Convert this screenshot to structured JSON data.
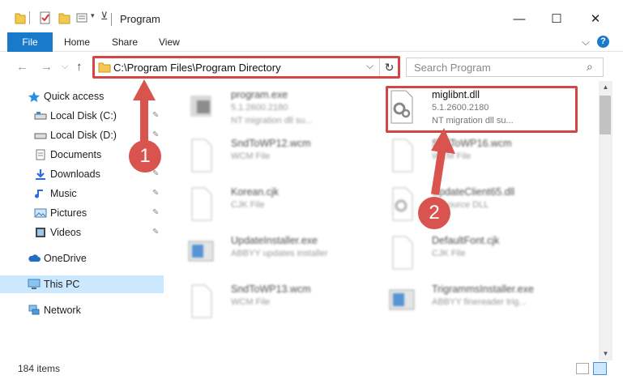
{
  "titlebar": {
    "title": "Program",
    "minimize": "—",
    "maximize": "☐",
    "close": "✕"
  },
  "ribbon": {
    "tabs": [
      "File",
      "Home",
      "Share",
      "View"
    ],
    "expand": "⌵",
    "help": "?"
  },
  "address": {
    "path": "C:\\Program Files\\Program Directory",
    "dropdown": "⌵",
    "refresh": "↻"
  },
  "search": {
    "placeholder": "Search Program",
    "icon": "⌕"
  },
  "nav": {
    "back": "←",
    "forward": "→",
    "recent": "⌵",
    "up": "↑"
  },
  "sidebar": {
    "items": [
      {
        "label": "Quick access",
        "icon": "star-icon"
      },
      {
        "label": "Local Disk (C:)",
        "icon": "drive-icon",
        "pinned": true
      },
      {
        "label": "Local Disk (D:)",
        "icon": "drive-icon",
        "pinned": true
      },
      {
        "label": "Documents",
        "icon": "documents-icon",
        "pinned": true
      },
      {
        "label": "Downloads",
        "icon": "download-icon",
        "pinned": true
      },
      {
        "label": "Music",
        "icon": "music-icon",
        "pinned": true
      },
      {
        "label": "Pictures",
        "icon": "pictures-icon",
        "pinned": true
      },
      {
        "label": "Videos",
        "icon": "videos-icon",
        "pinned": true
      },
      {
        "label": "OneDrive",
        "icon": "cloud-icon"
      },
      {
        "label": "This PC",
        "icon": "computer-icon",
        "selected": true
      },
      {
        "label": "Network",
        "icon": "network-icon"
      }
    ],
    "pin_glyph": "📌"
  },
  "files": [
    {
      "name": "program.exe",
      "line2": "5.1.2600.2180",
      "line3": "NT migration dll su...",
      "icon": "exe-icon"
    },
    {
      "name": "miglibnt.dll",
      "line2": "5.1.2600.2180",
      "line3": "NT migration dll su...",
      "icon": "dll-gear-icon"
    },
    {
      "name": "SndToWP12.wcm",
      "line2": "WCM File",
      "line3": "",
      "icon": "file-icon"
    },
    {
      "name": "SndToWP16.wcm",
      "line2": "WCM File",
      "line3": "",
      "icon": "file-icon"
    },
    {
      "name": "Korean.cjk",
      "line2": "CJK File",
      "line3": "",
      "icon": "file-icon"
    },
    {
      "name": "UpdateClient65.dll",
      "line2": "Resource DLL",
      "line3": "",
      "icon": "dll-gear-icon"
    },
    {
      "name": "UpdateInstaller.exe",
      "line2": "ABBYY updates installer",
      "line3": "",
      "icon": "exe-icon"
    },
    {
      "name": "DefaultFont.cjk",
      "line2": "CJK File",
      "line3": "",
      "icon": "file-icon"
    },
    {
      "name": "SndToWP13.wcm",
      "line2": "WCM File",
      "line3": "",
      "icon": "file-icon"
    },
    {
      "name": "TrigrammsInstaller.exe",
      "line2": "ABBYY finereader trig...",
      "line3": "",
      "icon": "exe-icon"
    }
  ],
  "status": {
    "count": "184 items"
  },
  "annotations": {
    "step1": "1",
    "step2": "2",
    "color": "#d64545"
  }
}
